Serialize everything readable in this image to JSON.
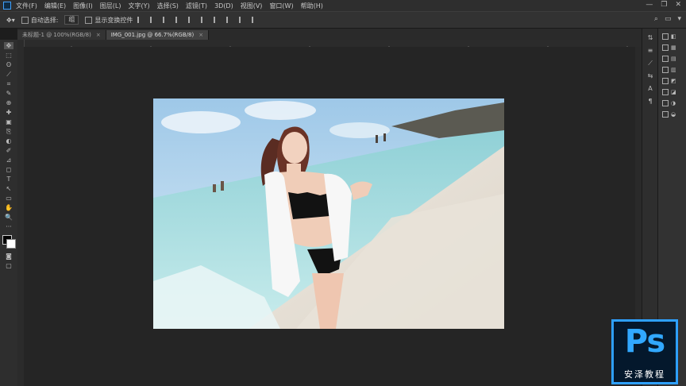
{
  "menubar": {
    "items": [
      "文件(F)",
      "编辑(E)",
      "图像(I)",
      "图层(L)",
      "文字(Y)",
      "选择(S)",
      "滤镜(T)",
      "3D(D)",
      "视图(V)",
      "窗口(W)",
      "帮助(H)"
    ],
    "window_controls": [
      "—",
      "❐",
      "✕"
    ]
  },
  "options": {
    "auto_select_label": "自动选择:",
    "auto_select_value": "组",
    "transform_controls_label": "显示变换控件"
  },
  "tabs": [
    {
      "label": "未标题-1 @ 100%(RGB/8)",
      "close": "×"
    },
    {
      "label": "IMG_001.jpg @ 66.7%(RGB/8)",
      "close": "×"
    }
  ],
  "tools": [
    "✥",
    "⬚",
    "ʘ",
    "⟋",
    "⌗",
    "✎",
    "⊕",
    "✚",
    "▣",
    "⎘",
    "◐",
    "✐",
    "⊿",
    "◻",
    "T",
    "↖",
    "▭",
    "✋",
    "🔍",
    "···"
  ],
  "right_panel1_icons": [
    "⇅",
    "≡",
    "⟋",
    "⇆",
    "A",
    "¶"
  ],
  "right_panel2_icons": [
    "◧",
    "▦",
    "▤",
    "▥",
    "◩",
    "◪",
    "◑",
    "◒"
  ],
  "colors": {
    "accent": "#31a8ff",
    "badge_bg": "#04182c",
    "app_bg": "#1d1d1d"
  },
  "badge": {
    "logo_text": "Ps",
    "caption": "安泽教程"
  }
}
